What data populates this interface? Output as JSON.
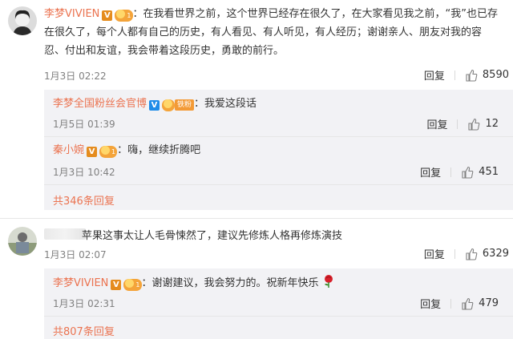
{
  "comments": [
    {
      "user": "李梦VIVIEN",
      "text_line1": "：在我看世界之前，这个世界已经存在很久了，在大家看见我之前，“我”也已存",
      "text_line2": "在很久了，每个人都有自己的历史，有人看见、有人听见，有人经历；谢谢亲人、朋友对我的容",
      "text_line3": "忍、付出和友谊，我会带着这段历史，勇敢的前行。",
      "time": "1月3日 02:22",
      "reply_label": "回复",
      "likes": "8590",
      "replies": [
        {
          "user": "李梦全国粉丝会官博",
          "fan_label": "铁粉",
          "text": "：我爱这段话",
          "time": "1月5日 01:39",
          "reply_label": "回复",
          "likes": "12"
        },
        {
          "user": "秦小婉",
          "text": "：嗨，继续折腾吧",
          "time": "1月3日 10:42",
          "reply_label": "回复",
          "likes": "451"
        }
      ],
      "more_label": "共346条回复"
    },
    {
      "user": "",
      "text_line1": "苹果这事太让人毛骨悚然了，建议先修炼人格再修炼演技",
      "time": "1月3日 02:07",
      "reply_label": "回复",
      "likes": "6329",
      "replies": [
        {
          "user": "李梦VIVIEN",
          "text": "：谢谢建议，我会努力的。祝新年快乐",
          "time": "1月3日 02:31",
          "reply_label": "回复",
          "likes": "479"
        }
      ],
      "more_label": "共807条回复"
    }
  ],
  "badges": {
    "verified": "V",
    "fan_level": "1"
  },
  "icons": {
    "like": "thumbs-up-icon",
    "rose": "rose-emoji-icon"
  },
  "colors": {
    "username": "#eb7350",
    "reply_bg": "#f2f2f5",
    "verified": "#e58c1e"
  }
}
